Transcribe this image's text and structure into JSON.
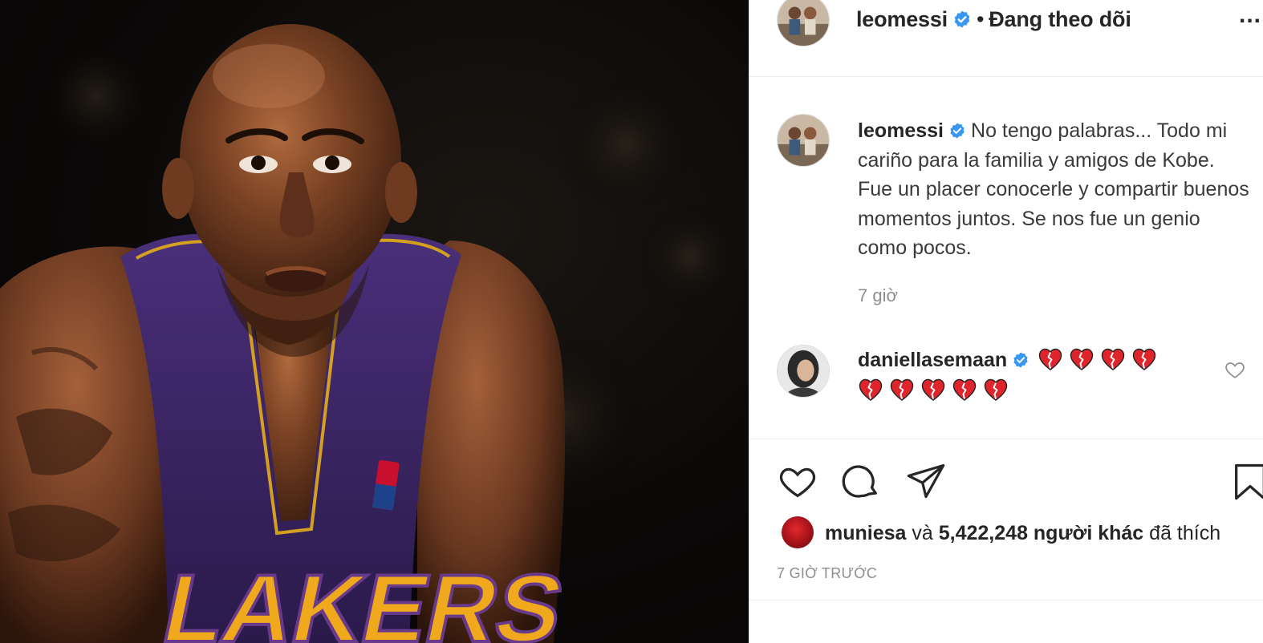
{
  "post": {
    "image_description_icon": "photo",
    "jersey_text": "LAKERS"
  },
  "header": {
    "username": "leomessi",
    "separator": "•",
    "follow_status": "Đang theo dõi",
    "more_label": "..."
  },
  "caption": {
    "username": "leomessi",
    "text": "No tengo palabras... Todo mi cariño para la familia y amigos de Kobe. Fue un placer conocerle y compartir buenos momentos juntos. Se nos fue un genio como pocos.",
    "time": "7 giờ"
  },
  "comment": {
    "username": "daniellasemaan",
    "heart_count": 9
  },
  "likes": {
    "user": "muniesa",
    "and": "và",
    "count_text": "5,422,248 người khác",
    "suffix": "đã thích"
  },
  "timestamp": "7 GIỜ TRƯỚC",
  "colors": {
    "verified": "#3897f0",
    "heart": "#e0242b",
    "muted": "#8e8e8e",
    "text": "#262626"
  }
}
